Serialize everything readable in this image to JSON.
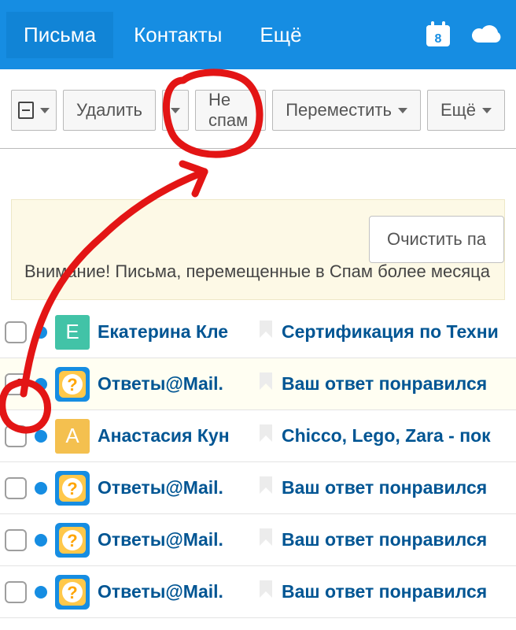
{
  "nav": {
    "mail": "Письма",
    "contacts": "Контакты",
    "more": "Ещё",
    "calendar_day": "8"
  },
  "toolbar": {
    "delete": "Удалить",
    "not_spam": "Не спам",
    "move": "Переместить",
    "more": "Ещё"
  },
  "notice": {
    "clear": "Очистить па",
    "text": "Внимание! Письма, перемещенные в Спам более месяца"
  },
  "rows": [
    {
      "checked": false,
      "avatar_type": "letter",
      "avatar_bg": "#42c3a7",
      "avatar_letter": "Е",
      "sender": "Екатерина Кле",
      "subject": "Сертификация по Техни"
    },
    {
      "checked": true,
      "avatar_type": "q",
      "sender": "Ответы@Mail.",
      "subject": "Ваш ответ понравился"
    },
    {
      "checked": false,
      "avatar_type": "letter",
      "avatar_bg": "#f4c04f",
      "avatar_letter": "А",
      "sender": "Анастасия Кун",
      "subject": "Chicco, Lego, Zara - пок"
    },
    {
      "checked": false,
      "avatar_type": "q",
      "sender": "Ответы@Mail.",
      "subject": "Ваш ответ понравился"
    },
    {
      "checked": false,
      "avatar_type": "q",
      "sender": "Ответы@Mail.",
      "subject": "Ваш ответ понравился"
    },
    {
      "checked": false,
      "avatar_type": "q",
      "sender": "Ответы@Mail.",
      "subject": "Ваш ответ понравился"
    }
  ]
}
